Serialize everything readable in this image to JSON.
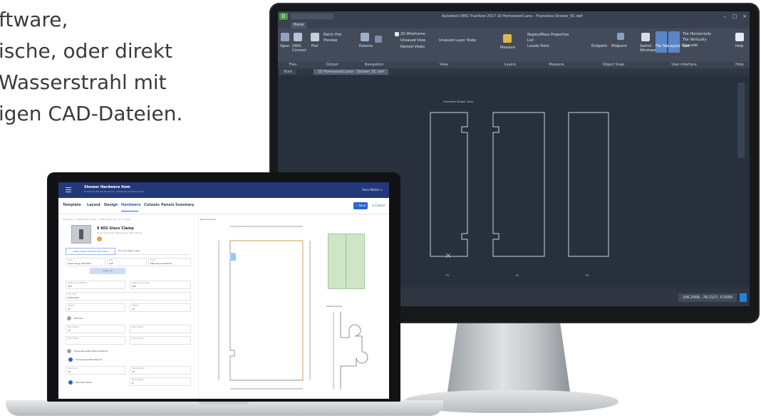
{
  "heading": {
    "lines": [
      "ftware,",
      "ische, oder direkt",
      "Wasserstrahl mit",
      "igen CAD-Dateien."
    ]
  },
  "acad": {
    "logo_letter": "D",
    "title": "Autodesk DWG TrueView 2017   10 Homewood Lane - Frameless Shower_EC.dwf",
    "ribbon_tab": "Home",
    "window_buttons": [
      "–",
      "□",
      "×"
    ],
    "groups": [
      "Files",
      "Output",
      "Navigation",
      "View",
      "Layers",
      "Measure",
      "Object Snap",
      "User Interface",
      "Help"
    ],
    "ribbon_items": {
      "open": "Open",
      "dwg_convert": "DWG Convert",
      "plot": "Plot",
      "batch_plot": "Batch Plot",
      "preview": "Preview",
      "extents": "Extents",
      "wireframe": "2D Wireframe",
      "unsaved_view": "Unsaved View",
      "named_views": "Named Views",
      "layout_state": "Unsaved Layer State",
      "measure": "Measure",
      "region_props": "Region/Mass Properties",
      "list": "List",
      "locate_point": "Locate Point",
      "endpoint": "Endpoint",
      "midpoint": "Midpoint",
      "switch_windows": "Switch Windows",
      "file_tabs": "File Tabs",
      "layout_tabs": "Layout Tabs",
      "tile_h": "Tile Horizontally",
      "tile_v": "Tile Vertically",
      "cascade": "Cascade",
      "user_interface": "User Interface",
      "help": "Help"
    },
    "doc_tabs": [
      "Start",
      "10 Homewood Lane - Shower_EC.dwf"
    ],
    "drawing_caption": "Frameless Shower Glass",
    "panel_labels": [
      "P1",
      "P2",
      "P3"
    ],
    "coords": "106.2568, -78.2127, 0.0000"
  },
  "app": {
    "title": "Shower Hardware Item",
    "subtitle": "Frameless Shower Enclosure - Hardware Selection Panel",
    "user": "Reza Walker ▾",
    "nav_tabs": [
      "Template",
      "Layout",
      "Design",
      "Hardware",
      "Cutouts",
      "Panels",
      "Summary"
    ],
    "active_tab": "Hardware",
    "save_label": "✓ Save",
    "cancel_label": "✕ Cancel",
    "breadcrumb": "Hardware > 8 802 Glass Clamp > Glass Clamp 90° (1/2\" Glass)",
    "product_title": "8 802 Glass Clamp",
    "product_subtitle": "Glass Clamp 90° Glass-Glass, Satin Nickel",
    "accent": "#e3a23a",
    "tab_primary": "Glass Hinge Left Side View Glass",
    "tab_secondary": "Hole_P2_Right edge",
    "fields": {
      "glass_label": "Glass",
      "glass_value": "Glass Hinge Left 0003",
      "side_label": "Side",
      "side_value": "Left",
      "finish_label": "Finish",
      "finish_value": "Manually positioned",
      "apply_button": "Apply All",
      "dist_bottom_label": "Distance from Bottom",
      "dist_bottom_value": "200",
      "dist_edge_label": "Distance from Edge",
      "dist_edge_value": "Max",
      "item_type_label": "Item Type",
      "item_type_value": "Glass Item",
      "offset_x_label": "Offset X",
      "offset_x_value": "20",
      "offset_y_label": "Offset Y",
      "offset_y_value": "20",
      "notches_label": "Notches",
      "notch_depth_label": "Notch Depth",
      "notch_depth_value": "10",
      "notch_height_label": "Notch Height",
      "notch_width_label": "Notch Width",
      "notch_radius_label": "Notch Radius",
      "show_notch_label": "Show Generated Notch Options",
      "show_hole_label": "Show Generated Options",
      "hole_count_label": "Hole Count",
      "hole_count_value": "16",
      "hole_dist_label": "Hole Distance",
      "hole_dist_value": "15",
      "standard_notch_label": "Standard Notch",
      "notch_radius2_label": "Notch Radius",
      "notch_radius2_value": "8"
    },
    "panel_drawing_label": "Panel Drawing",
    "detail_label": "Detail Drawing",
    "green_color": "#cfe6c6"
  }
}
